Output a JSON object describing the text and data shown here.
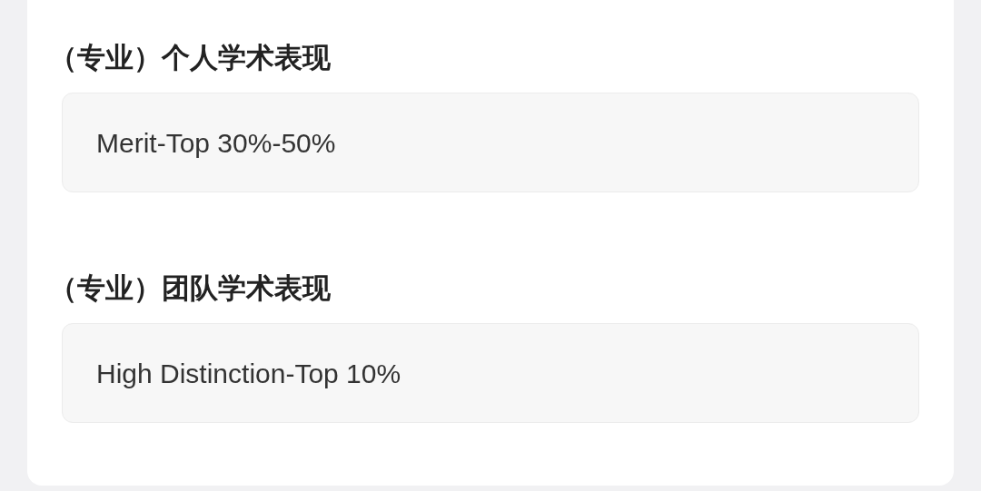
{
  "sections": [
    {
      "heading": "（专业）个人学术表现",
      "value": "Merit-Top 30%-50%"
    },
    {
      "heading": "（专业）团队学术表现",
      "value": "High Distinction-Top 10%"
    }
  ]
}
